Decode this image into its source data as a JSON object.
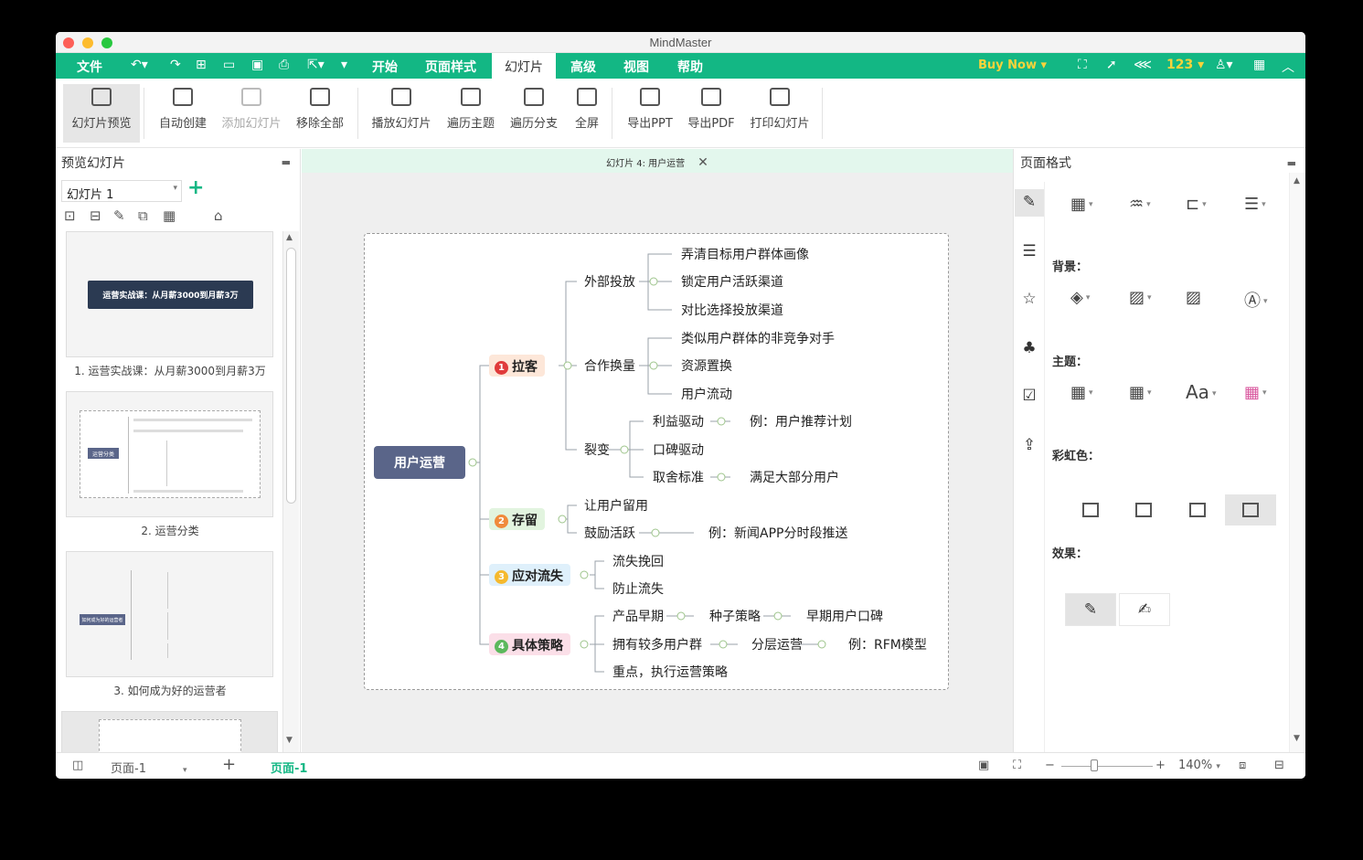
{
  "window": {
    "title": "MindMaster"
  },
  "menu": {
    "file": "文件",
    "tabs": [
      "开始",
      "页面样式",
      "幻灯片",
      "高级",
      "视图",
      "帮助"
    ],
    "active_tab": "幻灯片",
    "buy_now": "Buy Now",
    "counter": "123"
  },
  "ribbon": {
    "buttons": [
      "幻灯片预览",
      "自动创建",
      "添加幻灯片",
      "移除全部",
      "播放幻灯片",
      "遍历主题",
      "遍历分支",
      "全屏",
      "导出PPT",
      "导出PDF",
      "打印幻灯片"
    ]
  },
  "left_panel": {
    "title": "预览幻灯片",
    "selected_slide": "幻灯片 1",
    "thumbnails": [
      {
        "caption": "1. 运营实战课：从月薪3000到月薪3万",
        "banner": "运营实战课：从月薪3000到月薪3万"
      },
      {
        "caption": "2. 运营分类",
        "banner": "运营分类"
      },
      {
        "caption": "3. 如何成为好的运营者",
        "banner": "如何成为好的运营者"
      }
    ]
  },
  "canvas": {
    "tab_title": "幻灯片 4: 用户运营",
    "root": "用户运营",
    "branches": [
      {
        "num": "1",
        "label": "拉客",
        "color": "#fde7d9",
        "num_color": "#e03b3b"
      },
      {
        "num": "2",
        "label": "存留",
        "color": "#e2f4df",
        "num_color": "#f08a3b"
      },
      {
        "num": "3",
        "label": "应对流失",
        "color": "#dff0fb",
        "num_color": "#f5b92e"
      },
      {
        "num": "4",
        "label": "具体策略",
        "color": "#fbdfe8",
        "num_color": "#5cb85c"
      }
    ],
    "subtopics": {
      "waibu": "外部投放",
      "hezuo": "合作换量",
      "liebian": "裂变",
      "w1": "弄清目标用户群体画像",
      "w2": "锁定用户活跃渠道",
      "w3": "对比选择投放渠道",
      "h1": "类似用户群体的非竞争对手",
      "h2": "资源置换",
      "h3": "用户流动",
      "l1": "利益驱动",
      "l1e": "例：用户推荐计划",
      "l2": "口碑驱动",
      "l3": "取舍标准",
      "l3e": "满足大部分用户",
      "c1": "让用户留用",
      "c2": "鼓励活跃",
      "c2e": "例：新闻APP分时段推送",
      "y1": "流失挽回",
      "y2": "防止流失",
      "j1": "产品早期",
      "j1a": "种子策略",
      "j1b": "早期用户口碑",
      "j2": "拥有较多用户群",
      "j2a": "分层运营",
      "j2b": "例：RFM模型",
      "j3": "重点，执行运营策略"
    }
  },
  "right_panel": {
    "title": "页面格式",
    "background_label": "背景：",
    "theme_label": "主题：",
    "rainbow_label": "彩虹色：",
    "effect_label": "效果："
  },
  "status": {
    "page_select": "页面-1",
    "page_tab": "页面-1",
    "zoom": "140%"
  }
}
